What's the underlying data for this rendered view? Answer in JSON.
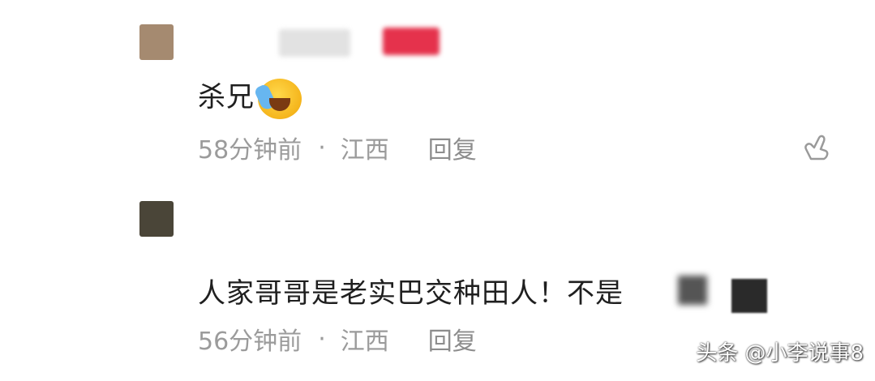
{
  "comments": [
    {
      "text": "杀兄",
      "emoji": "laughing-crying-emoji",
      "time": "58分钟前",
      "separator": "·",
      "location": "江西",
      "reply_label": "回复"
    },
    {
      "text": "人家哥哥是老实巴交种田人！不是",
      "time": "56分钟前",
      "separator": "·",
      "location": "江西",
      "reply_label": "回复"
    }
  ],
  "like_icon": "thumbs-up-icon",
  "watermark": "头条 @小李说事8",
  "colors": {
    "text": "#1f1f1f",
    "meta": "#9b9b9b",
    "avatar1": "#a58a70",
    "avatar2": "#4a4538",
    "name_blur_pink": "#e5324c"
  }
}
